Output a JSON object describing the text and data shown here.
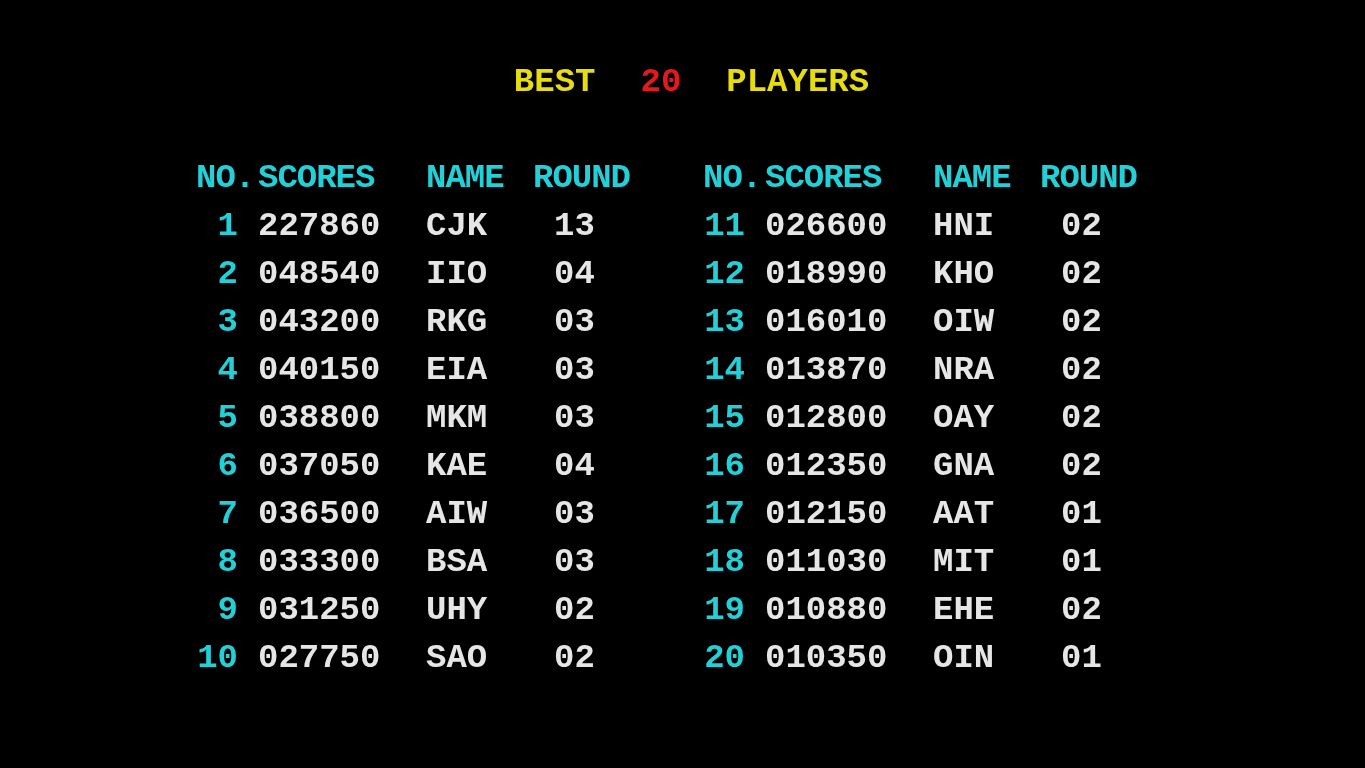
{
  "title": [
    {
      "text": "BEST",
      "color": "#e6dc10"
    },
    {
      "text": "20",
      "color": "#e81818"
    },
    {
      "text": "PLAYERS",
      "color": "#e6dc10"
    }
  ],
  "tables": [
    {
      "columns": [
        "NO.",
        "SCORES",
        "NAME",
        "ROUND"
      ],
      "rows": [
        {
          "no": "1",
          "score": "227860",
          "name": "CJK",
          "round": "13"
        },
        {
          "no": "2",
          "score": "048540",
          "name": "IIO",
          "round": "04"
        },
        {
          "no": "3",
          "score": "043200",
          "name": "RKG",
          "round": "03"
        },
        {
          "no": "4",
          "score": "040150",
          "name": "EIA",
          "round": "03"
        },
        {
          "no": "5",
          "score": "038800",
          "name": "MKM",
          "round": "03"
        },
        {
          "no": "6",
          "score": "037050",
          "name": "KAE",
          "round": "04"
        },
        {
          "no": "7",
          "score": "036500",
          "name": "AIW",
          "round": "03"
        },
        {
          "no": "8",
          "score": "033300",
          "name": "BSA",
          "round": "03"
        },
        {
          "no": "9",
          "score": "031250",
          "name": "UHY",
          "round": "02"
        },
        {
          "no": "10",
          "score": "027750",
          "name": "SAO",
          "round": "02"
        }
      ]
    },
    {
      "columns": [
        "NO.",
        "SCORES",
        "NAME",
        "ROUND"
      ],
      "rows": [
        {
          "no": "11",
          "score": "026600",
          "name": "HNI",
          "round": "02"
        },
        {
          "no": "12",
          "score": "018990",
          "name": "KHO",
          "round": "02"
        },
        {
          "no": "13",
          "score": "016010",
          "name": "OIW",
          "round": "02"
        },
        {
          "no": "14",
          "score": "013870",
          "name": "NRA",
          "round": "02"
        },
        {
          "no": "15",
          "score": "012800",
          "name": "OAY",
          "round": "02"
        },
        {
          "no": "16",
          "score": "012350",
          "name": "GNA",
          "round": "02"
        },
        {
          "no": "17",
          "score": "012150",
          "name": "AAT",
          "round": "01"
        },
        {
          "no": "18",
          "score": "011030",
          "name": "MIT",
          "round": "01"
        },
        {
          "no": "19",
          "score": "010880",
          "name": "EHE",
          "round": "02"
        },
        {
          "no": "20",
          "score": "010350",
          "name": "OIN",
          "round": "01"
        }
      ]
    }
  ]
}
